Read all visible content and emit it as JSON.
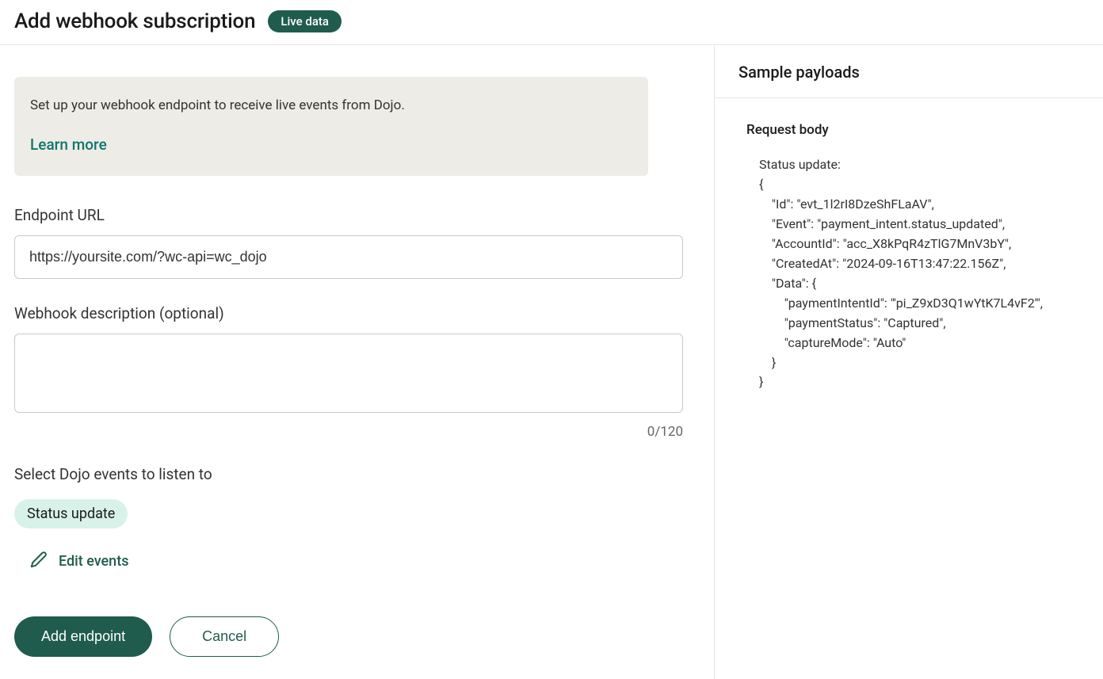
{
  "header": {
    "title": "Add webhook subscription",
    "badge": "Live data"
  },
  "info": {
    "text": "Set up your webhook endpoint to receive live events from Dojo.",
    "learn_more": "Learn more"
  },
  "form": {
    "endpoint_label": "Endpoint URL",
    "endpoint_value": "https://yoursite.com/?wc-api=wc_dojo",
    "description_label": "Webhook description (optional)",
    "description_value": "",
    "char_count": "0/120",
    "events_label": "Select Dojo events to listen to",
    "selected_event": "Status update",
    "edit_events": "Edit events"
  },
  "actions": {
    "primary": "Add endpoint",
    "secondary": "Cancel"
  },
  "sample": {
    "heading": "Sample payloads",
    "request_body_label": "Request body",
    "payload_title": "Status update:",
    "payload": {
      "Id": "evt_1l2rI8DzeShFLaAV",
      "Event": "payment_intent.status_updated",
      "AccountId": "acc_X8kPqR4zTlG7MnV3bY",
      "CreatedAt": "2024-09-16T13:47:22.156Z",
      "Data": {
        "paymentIntentId": "'pi_Z9xD3Q1wYtK7L4vF2'",
        "paymentStatus": "Captured",
        "captureMode": "Auto"
      }
    }
  }
}
